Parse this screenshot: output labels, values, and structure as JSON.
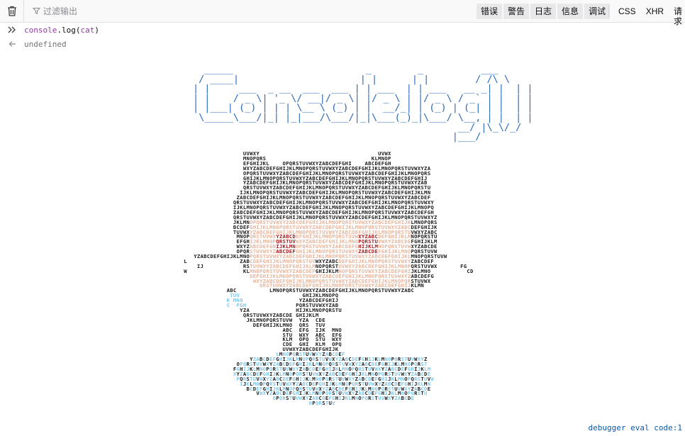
{
  "toolbar": {
    "filter_placeholder": "过滤输出",
    "levels": [
      "错误",
      "警告",
      "日志",
      "信息",
      "调试"
    ],
    "categories": [
      "CSS",
      "XHR",
      "请求"
    ]
  },
  "console": {
    "input": {
      "obj": "console",
      "dot": ".",
      "fn": "log",
      "open": "(",
      "arg": "cat",
      "close": ")"
    },
    "output": "undefined"
  },
  "art": {
    "banner_lines": [
      "  _____                       _        _          ___  ",
      " / ____|                     | |      | |        / /\\ \\ ",
      "| |     ___  _ __  ___  ___ | | ___  | | ___   __ _| |  | |",
      "| |    / _ \\| '_ \\/ __|/ _ \\| |/ _ \\ | |/ _ \\ / _` | |  | |",
      "| |___| (_) | | | \\__ \\ (_) | |  __/_| | (_) | (_| | |  | |",
      " \\_____\\___/|_| |_|___/\\___/|_|\\___(_)_|\\___/ \\__, | |  | |",
      "                                              __/ |\\_\\/_/ ",
      "                                             |___/        "
    ],
    "cat_rows": [
      "                    UVWXY                                    UVWX",
      "                    MNOPQRS                                KLMNOP",
      "                    EFGHIJKL    OPQRSTUVWXYZABCDEFGHI    ABCDEFGH",
      "                    WXYZABCDEFGHIJKLMNOPQRSTUVWXYZABCDEFGHIJKLMNOPQRSTUVWXYZA",
      "                    OPQRSTUVWXYZABCDEFGHIJKLMNOPQRSTUVWXYZABCDEFGHIJKLMNOPQRS",
      "                    GHIJKLMNOPQRSTUVWXYZABCDEFGHIJKLMNOPQRSTUVWXYZABCDEFGHIJ",
      "                    YZABCDEFGHIJKLMNOPQRSTUVWXYZABCDEFGHIJKLMNOPQRSTUVWXYZAB",
      "                    QRSTUVWXYZABCDEFGHIJKLMNOPQRSTUVWXYZABCDEFGHIJKLMNOPQRSTU",
      "                   IJKLMNOPQRSTUVWXYZABCDEFGHIJKLMNOPQRSTUVWXYZABCDEFGHIJKLMN",
      "                  ZABCDEFGHIJKLMNOPQRSTUVWXYZABCDEFGHIJKLMNOPQRSTUVWXYZABCDEF",
      "                 QRSTUVWXYZABCDEFGHIJKLMNOPQRSTUVWXYZABCDEFGHIJKLMNOPQRSTUVWXY",
      "                 IJKLMNOPQRSTUVWXYZABCDEFGHIJKLMNOPQRSTUVWXYZABCDEFGHIJKLMNOPQ",
      "                 ZABCDEFGHIJKLMNOPQRSTUVWXYZABCDEFGHIJKLMNOPQRSTUVWXYZABCDEFGH",
      "                 QRSTUVWXYZABCDEFGHIJKLMNOPQRSTUVWXYZABCDEFGHIJKLMNOPQRSTUVWXYZ",
      "                 JKLMNOPQRSTUVWXYZABCDEFGHIJKLMNOPQRSTUVWXYZABCDEFGHIJKLMNOPQRS",
      "                 BCDEFGHIJKLMNOPQRSTUVWXYZABCDEFGHIJKLMNOPQRSTUVWXYZABCDEFGHIJK",
      "                 TUVWXYZABCDEFGHIJKLMNOPQRSTUVWXYZABCDEFGHIJKLMNOPQRSTUVWXYZABC",
      "                  MNOPQRSTUVWXYZABCDEFGHIJKLMNOPQRSTUVWXYZABCDEFGHIJKLMNOPQRSTU",
      "                  EFGHIJKLMNOPQRSTUVWXYZABCDEFGHIJKLMNOPQRSTUVWXYZABCDEFGHIJKLM",
      "                  WXYZABCDEFGHIJKLMNOPQRSTUVWXYZABCDEFGHIJKLMNOPQRSTUVWXYZABCDE",
      "                  OPQRSTUVWXYZABCDEFGHIJKLMNOPQRSTUVWXYZABCDEFGHIJKLMNOPQRSTUVW",
      "     YZABCDEFGHIJKLMNOPQRSTUVWXYZABCDEFGHIJKLMNOPQRSTUVWXYZABCDEFGHIJKLMNOPQRSTUVW",
      "  L                ZABCDEFGHIJKLMNOPQRSTUVWXYZABCDEFGHIJKLMNOPQRSTUVWXYZABCDEF",
      "      IJ            RSTUVWXYZABCDEFGHIJKLMNOPQRSTUVWXYZABCDEFGHIJKLMNOPQRSTUVWX       FG",
      "  W                 KLMNOPQRSTUVWXYZABCDEFGHIJKLMNOPQRSTUVWXYZABCDEFGHIJKLMNO           CD",
      "                      DEFGHIJKLMNOPQRSTUVWXYZABCDEFGHIJKLMNOPQRSTUVWXYZABCDEFG",
      "                       WXYZABCDEFGHIJKLMNOPQRSTUVWXYZABCDEFGHIJKLMNOPQRSTUVWX",
      "                         QRSTUVWXYZABCDEFGHIJKLMNOPQRSTUVWXYZABCDEFGHIJKLMN",
      "               ABC          LMNOPQRSTUVWXYZABCDEFGHIJKLMNOPQRSTUVWXYZABC",
      "                TUV                   GHIJKLMNOPQ",
      "               K MNO                 YZABCDEFGHIJ",
      "               C  FGH               PQRSTUVWXYZAB",
      "                   YZA              HIJKLMNOPQRSTU",
      "                    QRSTUVWXYZABCDE GHIJKLM",
      "                     JKLMNOPQRSTUVW  YZA  CDE",
      "                       DEFGHIJKLMNO  QRS  TUV",
      "                                ABC  EFG  IJK  MNO",
      "                                STU  WXY  ABC  EFG",
      "                                KLM  OPQ  STU  WXY",
      "                                CDE  GHI  KLM  OPQ",
      "                                UVWXYZABCDEFGHIJK",
      "                              LMNOPQRSTUVWXYZABCDEF",
      "                      YZABCDEFGHIJKLMNOPQRSTUVWXYZABCDEFGHIJKLMNOPQRSTUVWXYZ",
      "                  OPQRSTUVWXYZABCDEFGHIJKLMNOPQRSTUVWXYZABCDEFGHIJKLMNOPQRST",
      "                 FGHIJKLMNOPQRSTUVWXYZABCDEFGHIJKLMNOPQRSTUVWXYZABCDEFGHIJKLM",
      "                 XYZABCDEFGHIJKLMNOPQRSTUVWXYZABCDEFGHIJKLMNOPQRSTUVWXYZABCDE",
      "                  PQRSTUVWXYZABCDEFGHIJKLMNOPQRSTUVWXYZABCDEFGHIJKLMNOPQRSTUVW",
      "                   IJKLMNOPQRSTUVWXYZABCDEFGHIJKLMNOPQRSTUVWXYZABCDEFGHIJKLMN",
      "                     BCDEFGHIJKLMNOPQRSTUVWXYZABCDEFGHIJKLMNOPQRSTUVWXYZABCDE",
      "                        VWXYZABCDEFGHIJKLMNOPQRSTUVWXYZABCDEFGHIJKLMNOPQRSTU",
      "                             OPQRSTUVWXYZABCDEFGHIJKLMNOPQRSTUVWXYZABCDE",
      "                                        OPQRSTUV"
    ]
  },
  "footer": "debugger eval code:1",
  "colors": {
    "banner_blue": "#2b6ab8",
    "banner_pink": "#c8259f",
    "cat_black": "#1a1a1a",
    "cat_skin": "#e8b49a",
    "cat_red": "#a8191b",
    "cat_blue": "#7fc6e8",
    "link_blue": "#0a57a6"
  }
}
